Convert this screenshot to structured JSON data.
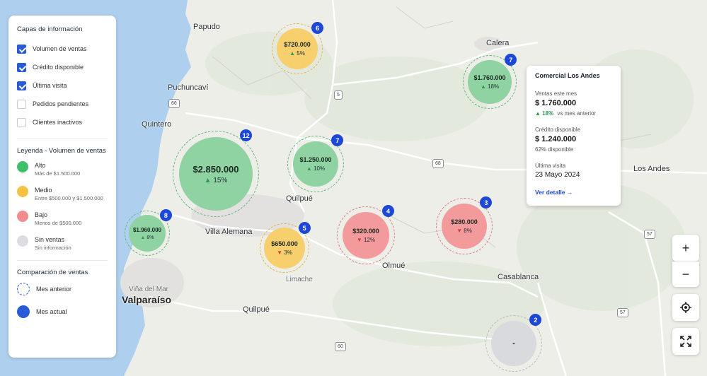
{
  "panel": {
    "layers_title": "Capas de información",
    "layers": [
      {
        "label": "Volumen de ventas",
        "checked": true
      },
      {
        "label": "Crédito disponible",
        "checked": true
      },
      {
        "label": "Última visita",
        "checked": true
      },
      {
        "label": "Pedidos pendientes",
        "checked": false
      },
      {
        "label": "Clientes inactivos",
        "checked": false
      }
    ],
    "legend_title": "Leyenda - Volumen de ventas",
    "legend": [
      {
        "label": "Alto",
        "desc": "Más de $1.500.000",
        "color": "#3fbf6a"
      },
      {
        "label": "Medio",
        "desc": "Entre $500.000 y $1.500.000",
        "color": "#f6c244"
      },
      {
        "label": "Bajo",
        "desc": "Menos de $500.000",
        "color": "#f28c8f"
      },
      {
        "label": "Sin ventas",
        "desc": "Sin información",
        "color": "#dcdde0"
      }
    ],
    "compare_title": "Comparación de ventas",
    "compare": [
      {
        "label": "Mes anterior"
      },
      {
        "label": "Mes actual"
      }
    ]
  },
  "places": {
    "papudo": "Papudo",
    "calera": "Calera",
    "puchuncavi": "Puchuncaví",
    "quintero": "Quintero",
    "quilpue1": "Quilpué",
    "villa_alemana": "Villa Alemana",
    "olmue": "Olmué",
    "casablanca": "Casablanca",
    "valparaiso": "Valparaíso",
    "quilpue2": "Quilpué",
    "los_andes": "Los Andes",
    "vina": "Viña del Mar",
    "limache": "Limache"
  },
  "routes": {
    "r66": "66",
    "r5": "5",
    "r68": "68",
    "r57a": "57",
    "r57b": "57",
    "r60": "60"
  },
  "bubbles": [
    {
      "id": "b6",
      "value": "$720.000",
      "change": "5%",
      "dir": "up",
      "count": "6",
      "tier": "medio"
    },
    {
      "id": "b7a",
      "value": "$1.760.000",
      "change": "18%",
      "dir": "up",
      "count": "7",
      "tier": "alto"
    },
    {
      "id": "b12",
      "value": "$2.850.000",
      "change": "15%",
      "dir": "up",
      "count": "12",
      "tier": "alto"
    },
    {
      "id": "b7b",
      "value": "$1.250.000",
      "change": "10%",
      "dir": "up",
      "count": "7",
      "tier": "alto"
    },
    {
      "id": "b8",
      "value": "$1.960.000",
      "change": "8%",
      "dir": "up",
      "count": "8",
      "tier": "alto"
    },
    {
      "id": "b4",
      "value": "$320.000",
      "change": "12%",
      "dir": "down",
      "count": "4",
      "tier": "bajo"
    },
    {
      "id": "b3",
      "value": "$280.000",
      "change": "8%",
      "dir": "down",
      "count": "3",
      "tier": "bajo"
    },
    {
      "id": "b5",
      "value": "$650.000",
      "change": "3%",
      "dir": "down",
      "count": "5",
      "tier": "medio"
    },
    {
      "id": "b2",
      "value": "-",
      "change": "",
      "dir": "",
      "count": "2",
      "tier": "sin"
    }
  ],
  "card": {
    "title": "Comercial Los Andes",
    "sales_label": "Ventas este mes",
    "sales_value": "$ 1.760.000",
    "sales_change": "18%",
    "sales_change_note": "vs mes anterior",
    "credit_label": "Crédito disponible",
    "credit_value": "$ 1.240.000",
    "credit_note": "62% disponible",
    "visit_label": "Última visita",
    "visit_date": "23 Mayo 2024",
    "link": "Ver detalle →"
  },
  "controls": {
    "zoom_in": "+",
    "zoom_out": "−"
  },
  "colors": {
    "alto": "#8fd3a2",
    "alto_ring": "#5fb87a",
    "medio": "#f7cf6d",
    "medio_ring": "#e6b24a",
    "bajo": "#f39a9c",
    "bajo_ring": "#e27b7e",
    "sin": "#d9dadd",
    "sin_ring": "#b8babf",
    "badge": "#1d47d6"
  }
}
